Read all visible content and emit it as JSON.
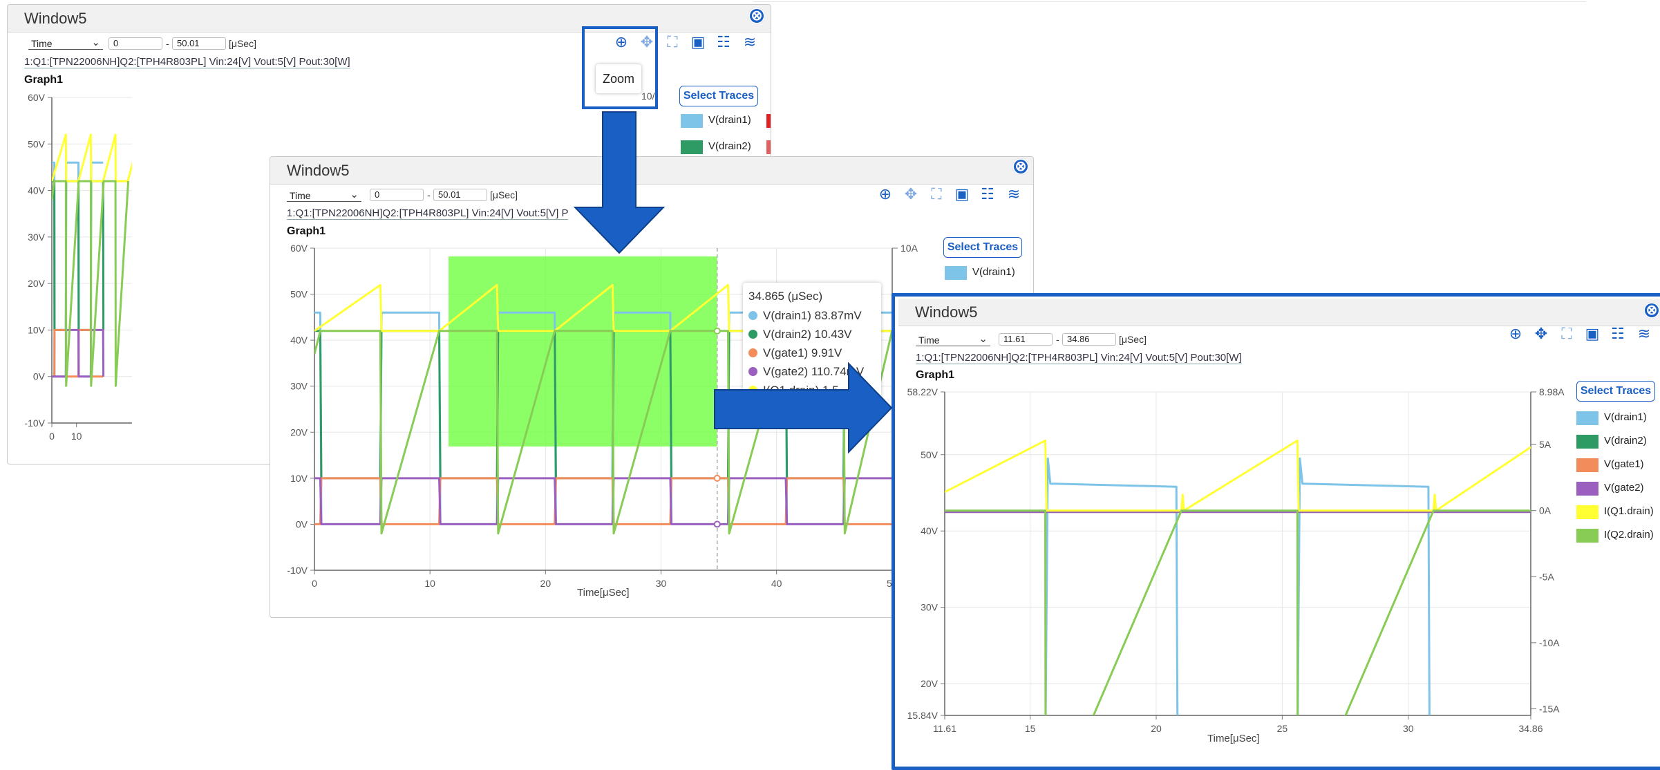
{
  "colors": {
    "accent": "#1a5fc4",
    "drain1": "#7ec4e8",
    "drain2": "#2e9a64",
    "gate1": "#f28c5a",
    "gate2": "#9b5fc0",
    "iq1": "#ffff33",
    "iq2": "#88cc55",
    "zoom_region": "#66ff33"
  },
  "window_title": "Window5",
  "close_icon": "⊗",
  "x_axis_mode": "Time",
  "range_separator": "-",
  "unit": "[μSec]",
  "circuit_desc": "1:Q1:[TPN22006NH]Q2:[TPH4R803PL] Vin:24[V]  Vout:5[V]  Pout:30[W]",
  "circuit_desc_partial": "1:Q1:[TPN22006NH]Q2:[TPH4R803PL] Vin:24[V]  Vout:5[V]  P",
  "graph_title": "Graph1",
  "select_traces": "Select Traces",
  "zoom_tooltip": "Zoom",
  "toolbar_icons": [
    "zoom-icon",
    "pan-icon",
    "fit-icon",
    "save-icon",
    "settings-icon",
    "waveform-icon"
  ],
  "windows": [
    {
      "id": "w1",
      "range_start": "0",
      "range_end": "50.01",
      "y_ticks": [
        "60V",
        "50V",
        "40V",
        "30V",
        "20V",
        "10V",
        "0V",
        "-10V"
      ],
      "x_ticks": [
        "0",
        "10"
      ],
      "right_tick_partial": "10/",
      "legend": [
        "V(drain1)",
        "V(drain2)"
      ]
    },
    {
      "id": "w2",
      "range_start": "0",
      "range_end": "50.01",
      "y_ticks": [
        "60V",
        "50V",
        "40V",
        "30V",
        "20V",
        "10V",
        "0V",
        "-10V"
      ],
      "x_ticks": [
        "0",
        "10",
        "20",
        "30",
        "40",
        "50"
      ],
      "x_label": "Time[μSec]",
      "right_tick": "10A",
      "legend": [
        "V(drain1)"
      ],
      "tooltip": {
        "header": "34.865 (μSec)",
        "rows": [
          {
            "label": "V(drain1) 83.87mV",
            "color": "#7ec4e8"
          },
          {
            "label": "V(drain2) 10.43V",
            "color": "#2e9a64"
          },
          {
            "label": "V(gate1) 9.91V",
            "color": "#f28c5a"
          },
          {
            "label": "V(gate2) 110.74mV",
            "color": "#9b5fc0"
          },
          {
            "label": "I(Q1.drain) 1.5",
            "color": "#ffff33"
          }
        ]
      }
    },
    {
      "id": "w3",
      "range_start": "11.61",
      "range_end": "34.86",
      "y_ticks": [
        "58.22V",
        "50V",
        "40V",
        "30V",
        "20V",
        "15.84V"
      ],
      "right_ticks": [
        "8.98A",
        "5A",
        "0A",
        "-5A",
        "-10A",
        "-15A"
      ],
      "x_ticks": [
        "11.61",
        "15",
        "20",
        "25",
        "30",
        "34.86"
      ],
      "x_label": "Time[μSec]",
      "legend": [
        "V(drain1)",
        "V(drain2)",
        "V(gate1)",
        "V(gate2)",
        "I(Q1.drain)",
        "I(Q2.drain)"
      ]
    }
  ],
  "chart_data": [
    {
      "type": "line",
      "title": "Graph1",
      "xlabel": "",
      "ylabel": "",
      "xlim": [
        0,
        50.01
      ],
      "ylim": [
        -10,
        60
      ],
      "series": [
        {
          "name": "V(drain1)",
          "x": [
            0,
            1.0,
            1.1,
            5.7,
            5.8,
            6.0,
            10.8,
            10.9,
            11.0,
            15.8,
            15.9,
            16.0,
            20.8
          ],
          "y": [
            46,
            46,
            0,
            0,
            46,
            46,
            46,
            0,
            0,
            0,
            46,
            46,
            46
          ]
        },
        {
          "name": "V(drain2)",
          "x": [
            0,
            1.0,
            1.1,
            5.7,
            5.8,
            10.8,
            10.9,
            11.0,
            15.8,
            15.9,
            20.8,
            20.9
          ],
          "y": [
            42,
            42,
            10,
            10,
            42,
            42,
            10,
            10,
            10,
            42,
            42,
            10
          ]
        },
        {
          "name": "V(gate1)",
          "x": [
            0,
            1.0,
            1.1,
            5.7,
            5.8,
            10.8,
            10.9,
            11.0,
            15.8,
            15.9,
            20.8
          ],
          "y": [
            0,
            0,
            10,
            10,
            0,
            0,
            10,
            10,
            10,
            0,
            0
          ]
        },
        {
          "name": "V(gate2)",
          "x": [
            0,
            1.0,
            1.1,
            5.7,
            5.8,
            10.8,
            10.9,
            15.8,
            15.9,
            20.8,
            20.9
          ],
          "y": [
            0,
            0,
            0,
            0,
            10,
            10,
            0,
            0,
            10,
            10,
            0
          ]
        },
        {
          "name": "I(Q1.drain)",
          "x": [
            0,
            5.7,
            5.8,
            10.8,
            15.8,
            15.9,
            20.8,
            25.8,
            25.9,
            30.8,
            35.8,
            35.9,
            40.8,
            45.8,
            45.9,
            50
          ],
          "y": [
            42,
            52,
            42,
            42,
            52,
            42,
            42,
            52,
            42,
            42,
            52,
            42,
            42,
            52,
            42,
            42
          ]
        },
        {
          "name": "I(Q2.drain)",
          "x": [
            0,
            1.0,
            1.1,
            5.7,
            5.8,
            10.9,
            11.0,
            15.8,
            15.9,
            21.0,
            21.1,
            25.8,
            25.9,
            31.0
          ],
          "y": [
            38,
            42,
            42,
            42,
            -2,
            42,
            42,
            42,
            -2,
            42,
            42,
            42,
            -2,
            42
          ]
        }
      ]
    },
    {
      "type": "line",
      "title": "Graph1",
      "xlabel": "Time[μSec]",
      "ylabel": "",
      "xlim": [
        0,
        50.01
      ],
      "ylim": [
        -10,
        60
      ],
      "zoom_selection_x": [
        11.61,
        34.86
      ],
      "series": [
        {
          "name": "V(drain1)",
          "x": [
            0,
            0.5,
            0.6,
            5.7,
            5.8,
            10.8,
            10.9,
            11.0,
            15.8,
            15.9,
            20.8,
            20.9,
            21.0,
            25.8,
            25.9,
            30.8,
            30.9,
            31.0,
            35.8,
            35.9,
            40.8,
            40.9,
            41.0,
            45.8,
            45.9,
            50
          ],
          "y": [
            46,
            46,
            0,
            0,
            46,
            46,
            0,
            0,
            0,
            46,
            46,
            0,
            0,
            0,
            46,
            46,
            0,
            0,
            0,
            46,
            46,
            0,
            0,
            0,
            46,
            46
          ]
        },
        {
          "name": "V(drain2)",
          "x": [
            0,
            0.5,
            0.6,
            5.7,
            5.8,
            10.8,
            10.9,
            15.8,
            15.9,
            20.8,
            20.9,
            25.8,
            25.9,
            30.8,
            30.9,
            35.8,
            35.9,
            40.8,
            40.9,
            45.8,
            45.9,
            50
          ],
          "y": [
            42,
            42,
            10,
            10,
            42,
            42,
            10,
            10,
            42,
            42,
            10,
            10,
            42,
            42,
            10,
            10,
            42,
            42,
            10,
            10,
            42,
            42
          ]
        },
        {
          "name": "V(gate1)",
          "x": [
            0,
            0.5,
            0.6,
            5.7,
            5.8,
            10.8,
            10.9,
            15.8,
            15.9,
            20.8,
            20.9,
            25.8,
            25.9,
            30.8,
            30.9,
            35.8,
            35.9,
            40.8,
            40.9,
            45.8,
            45.9,
            50
          ],
          "y": [
            0,
            0,
            10,
            10,
            0,
            0,
            10,
            10,
            0,
            0,
            10,
            10,
            0,
            0,
            10,
            10,
            0,
            0,
            10,
            10,
            0,
            0
          ]
        },
        {
          "name": "V(gate2)",
          "x": [
            0,
            0.5,
            0.6,
            5.7,
            5.8,
            10.8,
            10.9,
            15.8,
            15.9,
            20.8,
            20.9,
            25.8,
            25.9,
            30.8,
            30.9,
            35.8,
            35.9,
            40.8,
            40.9,
            45.8,
            45.9,
            50
          ],
          "y": [
            10,
            10,
            0,
            0,
            10,
            10,
            0,
            0,
            10,
            10,
            0,
            0,
            10,
            10,
            0,
            0,
            10,
            10,
            0,
            0,
            10,
            10
          ]
        },
        {
          "name": "I(Q1.drain)",
          "x": [
            0,
            5.7,
            5.8,
            10.8,
            15.8,
            15.9,
            20.8,
            25.8,
            25.9,
            30.8,
            35.8,
            35.9,
            40.8,
            45.8,
            45.9,
            50
          ],
          "y": [
            42,
            52,
            42,
            42,
            52,
            42,
            42,
            52,
            42,
            42,
            52,
            42,
            42,
            52,
            42,
            42
          ]
        },
        {
          "name": "I(Q2.drain)",
          "x": [
            0,
            0.5,
            0.6,
            5.7,
            5.8,
            10.8,
            10.9,
            15.8,
            15.9,
            20.8,
            20.9,
            25.8,
            25.9,
            30.8,
            30.9,
            35.8,
            35.9,
            40.8,
            40.9,
            45.8,
            45.9,
            50
          ],
          "y": [
            37,
            42,
            42,
            42,
            -2,
            42,
            42,
            42,
            -2,
            42,
            42,
            42,
            -2,
            42,
            42,
            42,
            -2,
            42,
            42,
            42,
            -2,
            42
          ]
        }
      ]
    },
    {
      "type": "line",
      "title": "Graph1",
      "xlabel": "Time[μSec]",
      "ylabel": "",
      "xlim": [
        11.61,
        34.86
      ],
      "ylim": [
        15.84,
        58.22
      ],
      "y2lim": [
        -15.5,
        8.98
      ],
      "series": [
        {
          "name": "V(drain1)",
          "axis": "left",
          "x": [
            11.61,
            15.6,
            15.7,
            15.8,
            20.8,
            20.85,
            20.9,
            25.6,
            25.7,
            25.8,
            30.8,
            30.85,
            30.9,
            34.86
          ],
          "y": [
            10,
            10,
            49.5,
            46.2,
            45.8,
            10,
            10,
            10,
            49.5,
            46.2,
            45.8,
            10,
            10,
            10
          ]
        },
        {
          "name": "V(drain2)",
          "axis": "left",
          "x": [
            11.61,
            34.86
          ],
          "y": [
            42.5,
            42.5
          ]
        },
        {
          "name": "V(gate1)",
          "axis": "left",
          "x": [
            11.61,
            34.86
          ],
          "y": [
            42.5,
            42.5
          ]
        },
        {
          "name": "V(gate2)",
          "axis": "left",
          "x": [
            11.61,
            34.86
          ],
          "y": [
            42.5,
            42.5
          ]
        },
        {
          "name": "I(Q1.drain)",
          "axis": "right",
          "x": [
            11.61,
            15.6,
            15.65,
            15.8,
            21.0,
            21.05,
            21.1,
            25.6,
            25.65,
            25.8,
            31.0,
            31.05,
            31.1,
            34.86
          ],
          "y": [
            1.4,
            5.3,
            0,
            0,
            0,
            1.2,
            0,
            5.3,
            0,
            0,
            0,
            1.2,
            0,
            4.8
          ]
        },
        {
          "name": "I(Q2.drain)",
          "axis": "right",
          "x": [
            11.61,
            15.6,
            15.61,
            17.4,
            21.0,
            25.6,
            25.61,
            27.4,
            31.0,
            34.86
          ],
          "y": [
            0,
            0,
            -16,
            -16,
            0,
            0,
            -16,
            -16,
            0,
            0
          ]
        }
      ]
    }
  ]
}
